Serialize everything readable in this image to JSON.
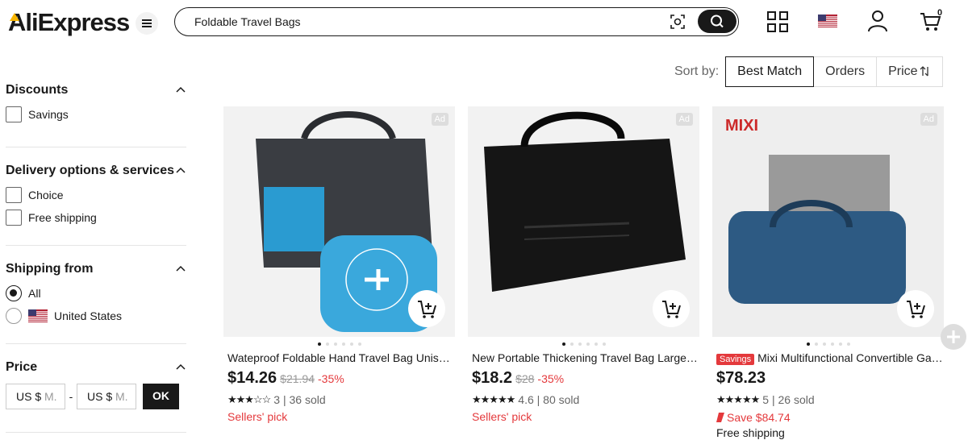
{
  "header": {
    "logo": "AliExpress",
    "search_value": "Foldable Travel Bags",
    "cart_count": "0",
    "icons": [
      "menu-icon",
      "camera-icon",
      "search-icon",
      "qr-code-icon",
      "us-flag-icon",
      "user-icon",
      "cart-icon"
    ]
  },
  "sidebar": {
    "discounts": {
      "title": "Discounts",
      "options": [
        "Savings"
      ]
    },
    "delivery": {
      "title": "Delivery options & services",
      "options": [
        "Choice",
        "Free shipping"
      ]
    },
    "shipping": {
      "title": "Shipping from",
      "options": [
        "All",
        "United States"
      ]
    },
    "price": {
      "title": "Price",
      "min_placeholder": "M.",
      "max_placeholder": "M.",
      "currency": "US $",
      "dash": "-",
      "ok": "OK"
    }
  },
  "sort": {
    "label": "Sort by:",
    "options": [
      "Best Match",
      "Orders",
      "Price"
    ],
    "active": "Best Match"
  },
  "products": [
    {
      "ad": "Ad",
      "title": "Wateproof Foldable Hand Travel Bag Unisex Large",
      "price": "$14.26",
      "was": "$21.94",
      "discount": "-35%",
      "stars": "★★★☆☆",
      "rating": "3",
      "sold": "| 36 sold",
      "badge": "Sellers' pick"
    },
    {
      "ad": "Ad",
      "title": "New Portable Thickening Travel Bag Large Capacity",
      "price": "$18.2",
      "was": "$28",
      "discount": "-35%",
      "stars": "★★★★★",
      "rating": "4.6",
      "sold": "| 80 sold",
      "badge": "Sellers' pick"
    },
    {
      "ad": "Ad",
      "savings_tag": "Savings",
      "title": "Mixi Multifunctional Convertible Garment Bag",
      "price": "$78.23",
      "stars": "★★★★★",
      "rating": "5",
      "sold": "| 26 sold",
      "save": "Save $84.74",
      "shipping": "Free shipping",
      "brand_mark": "MIXI"
    }
  ],
  "colors": {
    "accent_red": "#e4393c",
    "text": "#191919",
    "muted": "#999999"
  }
}
